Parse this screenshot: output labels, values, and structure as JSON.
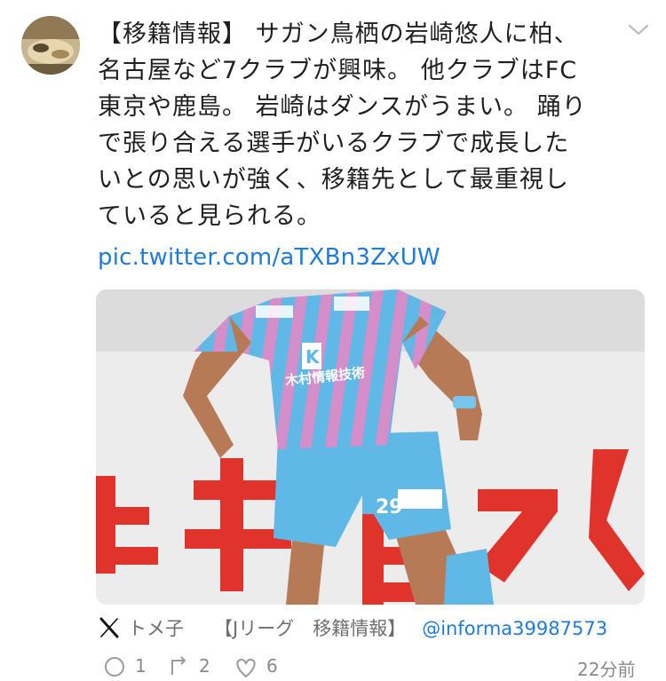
{
  "tweet": {
    "lines": [
      "【移籍情報】 サガン鳥栖の岩崎悠人に柏、",
      "名古屋など7クラブが興味。 他クラブはFC",
      "東京や鹿島。 岩崎はダンスがうまい。 踊り",
      "で張り合える選手がいるクラブで成長した",
      "いとの思いが強く、移籍先として最重視し",
      "ていると見られる。"
    ],
    "link": "pic.twitter.com/aTXBn3ZxUW"
  },
  "media": {
    "jersey_sponsor": "木村情報技術",
    "jersey_number": "29",
    "badge_text": "K",
    "background_sign": "キヒスク"
  },
  "source": {
    "author": "トメ子",
    "tags": "【Jリーグ　移籍情報】",
    "handle": "@informa39987573"
  },
  "actions": {
    "replies": "1",
    "retweets": "2",
    "likes": "6",
    "timestamp": "22分前"
  },
  "colors": {
    "link": "#1f7bd9",
    "text": "#1f1f1f",
    "meta": "#6f6f6f"
  },
  "icons": [
    "chevron-down-icon",
    "x-logo-icon",
    "reply-icon",
    "retweet-icon",
    "like-icon"
  ]
}
